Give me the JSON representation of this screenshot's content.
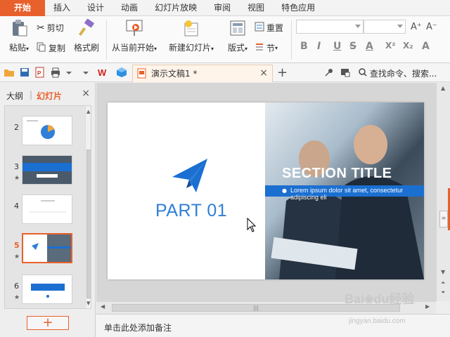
{
  "tabs": [
    "开始",
    "插入",
    "设计",
    "动画",
    "幻灯片放映",
    "审阅",
    "视图",
    "特色应用"
  ],
  "ribbon": {
    "paste": "粘贴",
    "cut": "剪切",
    "copy": "复制",
    "format_painter": "格式刷",
    "from_current": "从当前开始",
    "new_slide": "新建幻灯片",
    "layout": "版式",
    "reset": "重置",
    "section": "节",
    "font_grow": "A⁺",
    "font_shrink": "A⁻",
    "bold": "B",
    "italic": "I",
    "underline": "U",
    "strike": "S",
    "font_color": "A",
    "superscript": "X²",
    "subscript": "X₂",
    "clear_format": "A"
  },
  "document": {
    "tab_name": "演示文稿1 *"
  },
  "search": {
    "label": "查找命令、搜索..."
  },
  "left_panel": {
    "tab_outline": "大纲",
    "tab_slides": "幻灯片",
    "slides": [
      {
        "num": "2",
        "star": false
      },
      {
        "num": "3",
        "star": true
      },
      {
        "num": "4",
        "star": false
      },
      {
        "num": "5",
        "star": true
      },
      {
        "num": "6",
        "star": true
      }
    ],
    "active_slide": "5"
  },
  "slide": {
    "section_title": "SECTION TITLE",
    "band_text": "Lorem ipsum dolor sit amet, consectetur adipiscing eli",
    "part": "PART 01"
  },
  "notes": {
    "placeholder": "单击此处添加备注"
  },
  "watermark": {
    "brand": "Bai",
    "brand2": "du",
    "suffix": "经验",
    "url": "jingyan.baidu.com"
  },
  "colors": {
    "accent": "#e8602c",
    "blue": "#2f7fd8",
    "band": "#1b6fd1"
  }
}
